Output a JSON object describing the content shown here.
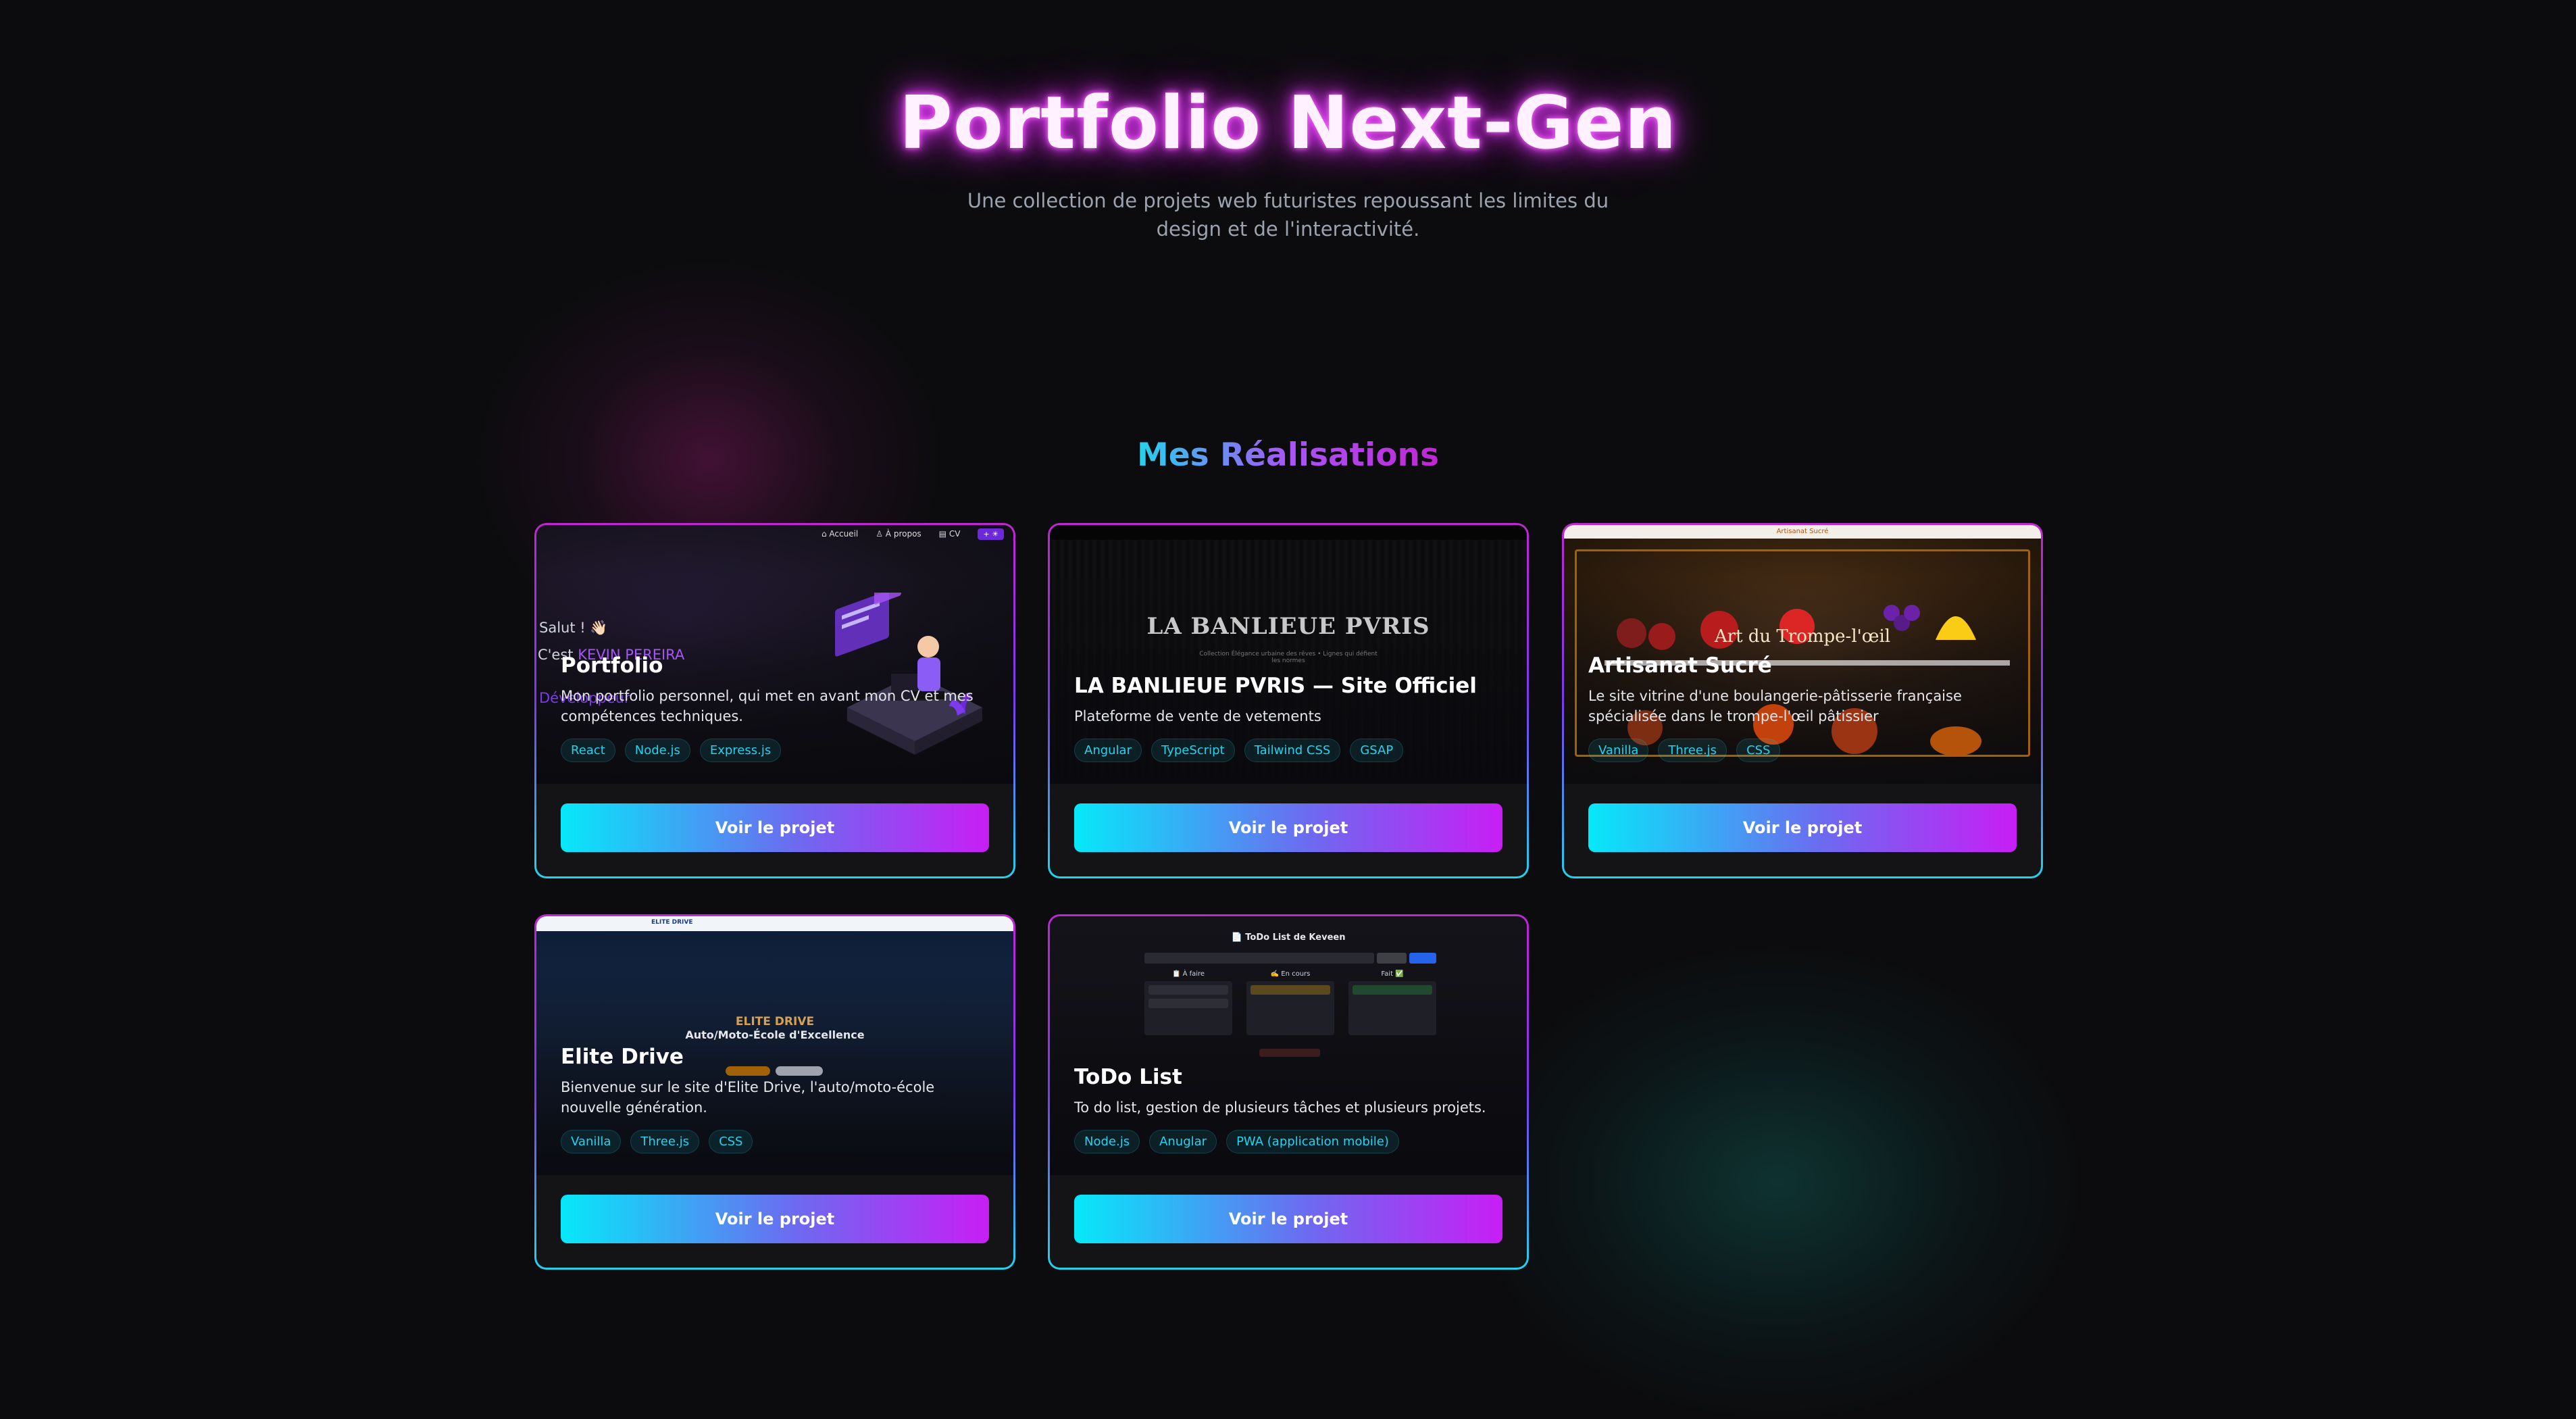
{
  "hero": {
    "title": "Portfolio Next-Gen",
    "subtitle": "Une collection de projets web futuristes repoussant les limites du design et de l'interactivité."
  },
  "section": {
    "title": "Mes Réalisations"
  },
  "colors": {
    "accent_cyan": "#22d3ee",
    "accent_purple": "#a855f7",
    "accent_magenta": "#c026d3",
    "background": "#0c0c0e"
  },
  "projects": [
    {
      "title": "Portfolio",
      "description": "Mon portfolio personnel, qui met en avant mon CV et mes compétences techniques.",
      "tags": [
        "React",
        "Node.js",
        "Express.js"
      ],
      "button": "Voir le projet",
      "preview": {
        "nav": [
          "⌂ Accueil",
          "♙ À propos",
          "▤ CV"
        ],
        "nav_button": "+ ☀",
        "greeting": "Salut ! 👋🏻",
        "intro_prefix": "C'est ",
        "intro_name": "KEVIN PEREIRA",
        "role": "Développeur"
      }
    },
    {
      "title": "LA BANLIEUE PVRIS — Site Officiel",
      "description": "Plateforme de vente de vetements",
      "tags": [
        "Angular",
        "TypeScript",
        "Tailwind CSS",
        "GSAP"
      ],
      "button": "Voir le projet",
      "preview": {
        "logo_text": "LA BANLIEUE PVRIS",
        "tagline": "Collection Élégance urbaine des rêves • Lignes qui défient les normes"
      }
    },
    {
      "title": "Artisanat Sucré",
      "description": "Le site vitrine d'une boulangerie-pâtisserie française spécialisée dans le trompe-l'œil pâtissier",
      "tags": [
        "Vanilla",
        "Three.js",
        "CSS"
      ],
      "button": "Voir le projet",
      "preview": {
        "brand": "Artisanat Sucré",
        "heading": "Art du Trompe-l'œil"
      }
    },
    {
      "title": "Elite Drive",
      "description": "Bienvenue sur le site d'Elite Drive, l'auto/moto-école nouvelle génération.",
      "tags": [
        "Vanilla",
        "Three.js",
        "CSS"
      ],
      "button": "Voir le projet",
      "preview": {
        "brand": "ELITE DRIVE",
        "heading": "ELITE DRIVE",
        "subheading": "Auto/Moto-École d'Excellence"
      }
    },
    {
      "title": "ToDo List",
      "description": "To do list, gestion de plusieurs tâches et plusieurs projets.",
      "tags": [
        "Node.js",
        "Anuglar",
        "PWA (application mobile)"
      ],
      "button": "Voir le projet",
      "preview": {
        "heading": "📄 ToDo List de Keveen",
        "columns": [
          "📋 À faire",
          "✍️ En cours",
          "Fait ✅"
        ]
      }
    }
  ]
}
